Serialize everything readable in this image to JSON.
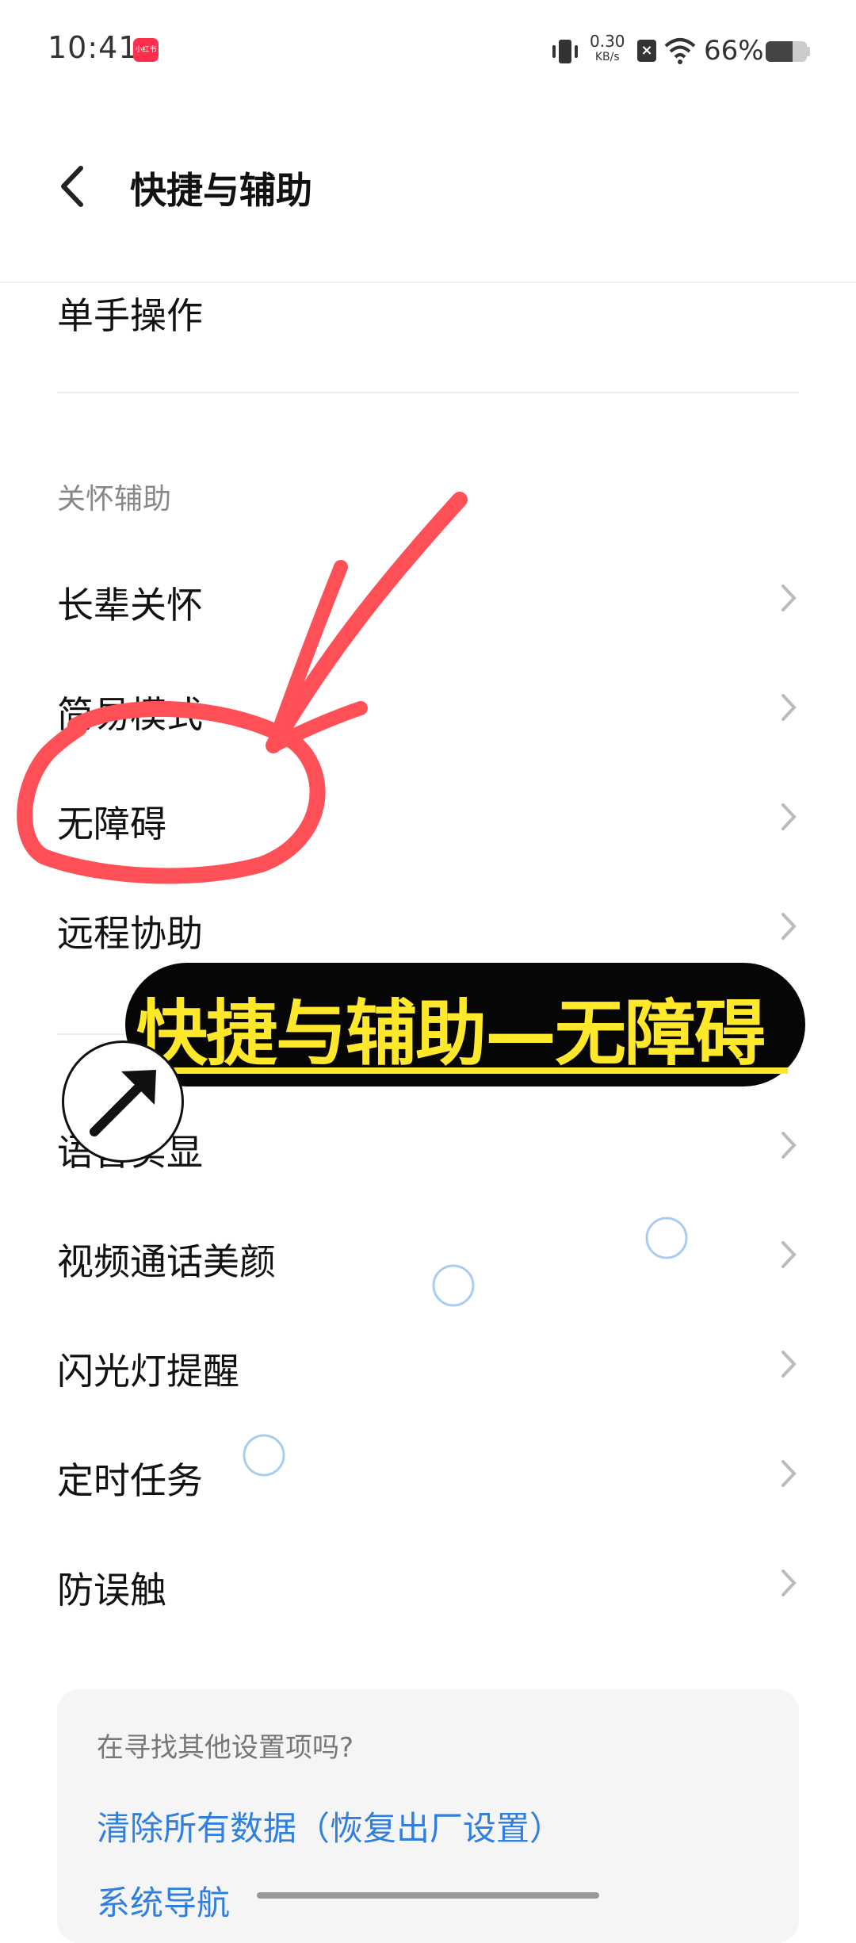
{
  "status_bar": {
    "time": "10:41",
    "app_badge": "小红书",
    "net_speed_value": "0.30",
    "net_speed_unit": "KB/s",
    "battery_percent": "66%",
    "battery_level": 0.66
  },
  "header": {
    "title": "快捷与辅助"
  },
  "list": {
    "partial_item": "单手操作",
    "section_title": "关怀辅助",
    "items": [
      "长辈关怀",
      "简易模式",
      "无障碍",
      "远程协助",
      "语音实显",
      "视频通话美颜",
      "闪光灯提醒",
      "定时任务",
      "防误触"
    ]
  },
  "annotation": {
    "banner_text": "快捷与辅助—无障碍"
  },
  "card": {
    "hint": "在寻找其他设置项吗?",
    "link1": "清除所有数据（恢复出厂设置）",
    "link2": "系统导航"
  },
  "colors": {
    "accent_link": "#2f7fe0",
    "annotation_red": "#ff4f57",
    "banner_yellow": "#ffe82a"
  }
}
